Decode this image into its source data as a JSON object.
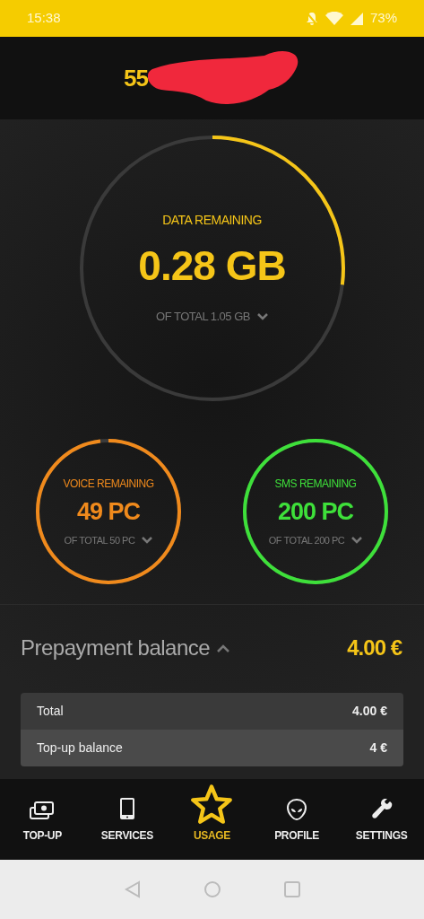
{
  "status_bar": {
    "time": "15:38",
    "battery": "73%"
  },
  "header": {
    "phone": "55"
  },
  "data_gauge": {
    "label": "DATA REMAINING",
    "value": "0.28 GB",
    "total": "OF TOTAL 1.05 GB",
    "level": 0.27,
    "color": "#f5c518"
  },
  "small_gauges": [
    {
      "label": "VOICE REMAINING",
      "value": "49 PC",
      "total": "OF TOTAL 50 PC",
      "level": 0.98,
      "color": "#f08a1c"
    },
    {
      "label": "SMS REMAINING",
      "value": "200 PC",
      "total": "OF TOTAL 200 PC",
      "level": 1,
      "color": "#3ee03a"
    }
  ],
  "balance": {
    "title": "Prepayment balance",
    "expanded": true,
    "amount": "4.00 €",
    "rows": [
      {
        "label": "Total",
        "value": "4.00 €"
      },
      {
        "label": "Top-up balance",
        "value": "4 €"
      }
    ]
  },
  "bottom_nav": [
    {
      "label": "TOP-UP",
      "kind": "money",
      "selected": false
    },
    {
      "label": "SERVICES",
      "kind": "phone",
      "selected": false
    },
    {
      "label": "USAGE",
      "kind": "star",
      "selected": true
    },
    {
      "label": "PROFILE",
      "kind": "alien",
      "selected": false
    },
    {
      "label": "SETTINGS",
      "kind": "wrench",
      "selected": false
    }
  ]
}
